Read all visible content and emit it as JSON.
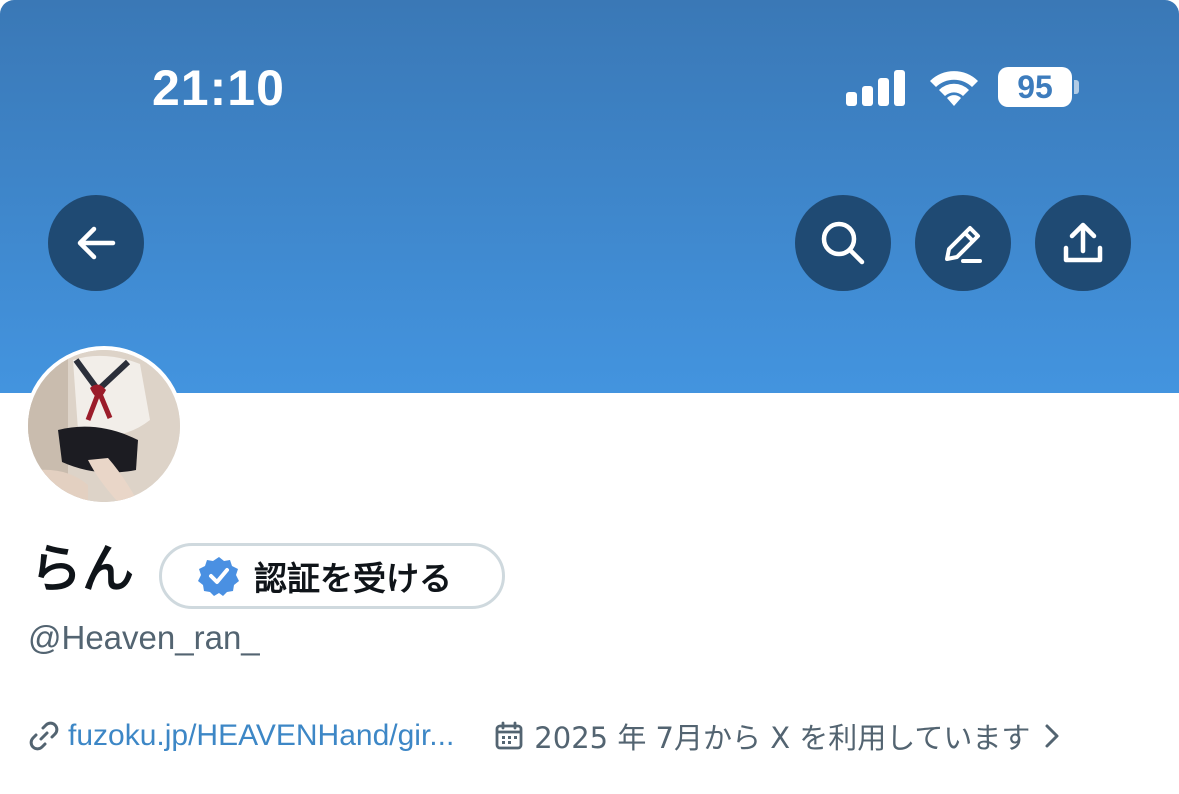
{
  "status_bar": {
    "time": "21:10",
    "battery_level": "95",
    "icons": [
      "signal-icon",
      "wifi-icon",
      "battery-icon"
    ]
  },
  "header": {
    "buttons": [
      {
        "name": "back-button",
        "icon": "arrow-left-icon"
      },
      {
        "name": "search-button",
        "icon": "search-icon"
      },
      {
        "name": "edit-button",
        "icon": "pencil-icon"
      },
      {
        "name": "share-button",
        "icon": "share-upload-icon"
      }
    ],
    "banner_color": "#4394df"
  },
  "profile": {
    "display_name": "らん",
    "verify_button_label": "認証を受ける",
    "handle": "@Heaven_ran_",
    "link": "fuzoku.jp/HEAVENHand/gir...",
    "joined": "2025 年 7月から X を利用しています"
  },
  "colors": {
    "accent": "#1d9bf0",
    "verified_badge": "#4a90e2",
    "secondary_text": "#536471",
    "header_button_bg": "#1f4a73"
  }
}
